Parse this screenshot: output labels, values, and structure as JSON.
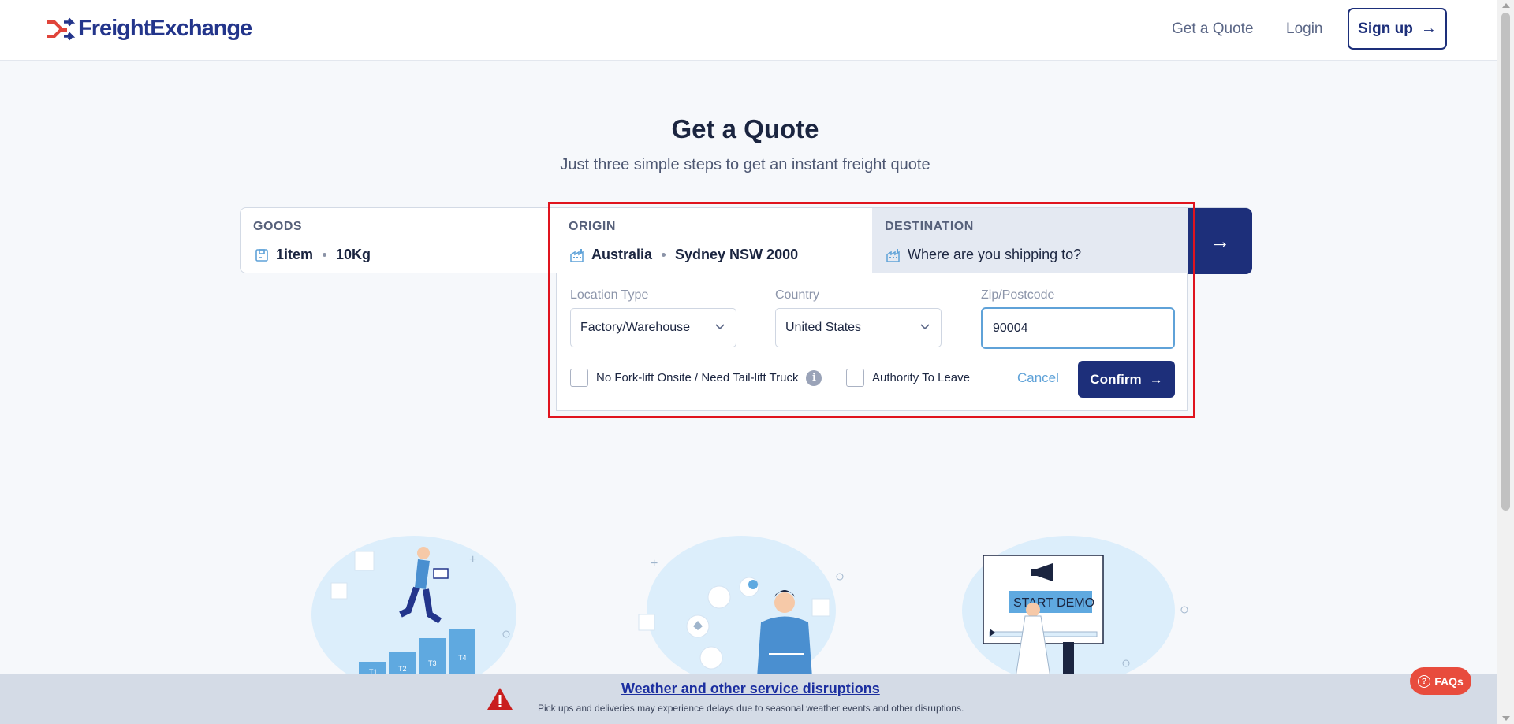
{
  "header": {
    "logo_text": "FreightExchange",
    "nav": {
      "get_quote": "Get a Quote",
      "login": "Login",
      "signup": "Sign up"
    }
  },
  "hero": {
    "title": "Get a Quote",
    "subtitle": "Just three simple steps to get an instant freight quote"
  },
  "quote_bar": {
    "goods": {
      "label": "GOODS",
      "items": "1item",
      "weight": "10Kg"
    },
    "origin": {
      "label": "ORIGIN",
      "country": "Australia",
      "place": "Sydney NSW 2000"
    },
    "destination": {
      "label": "DESTINATION",
      "placeholder": "Where are you shipping to?"
    }
  },
  "panel": {
    "location_type": {
      "label": "Location Type",
      "value": "Factory/Warehouse"
    },
    "country": {
      "label": "Country",
      "value": "United States"
    },
    "zip": {
      "label": "Zip/Postcode",
      "value": "90004"
    },
    "forklift_label": "No Fork-lift Onsite / Need Tail-lift Truck",
    "authority_label": "Authority To Leave",
    "cancel": "Cancel",
    "confirm": "Confirm"
  },
  "illustrations": {
    "steps": [
      "T1",
      "T2",
      "T3",
      "T4"
    ],
    "demo_text": "START DEMO"
  },
  "banner": {
    "title": "Weather and other service disruptions",
    "text": "Pick ups and deliveries may experience delays due to seasonal weather events and other disruptions."
  },
  "faq": {
    "label": "FAQs"
  },
  "colors": {
    "brand": "#1d2f7a",
    "accent": "#5fa2d8",
    "alert": "#e0141e",
    "faq": "#e84c3d"
  },
  "icons": {
    "goods": "box-icon",
    "origin": "factory-icon",
    "destination": "factory-icon",
    "go": "arrow-right-icon",
    "info": "info-icon",
    "warning": "warning-icon"
  }
}
